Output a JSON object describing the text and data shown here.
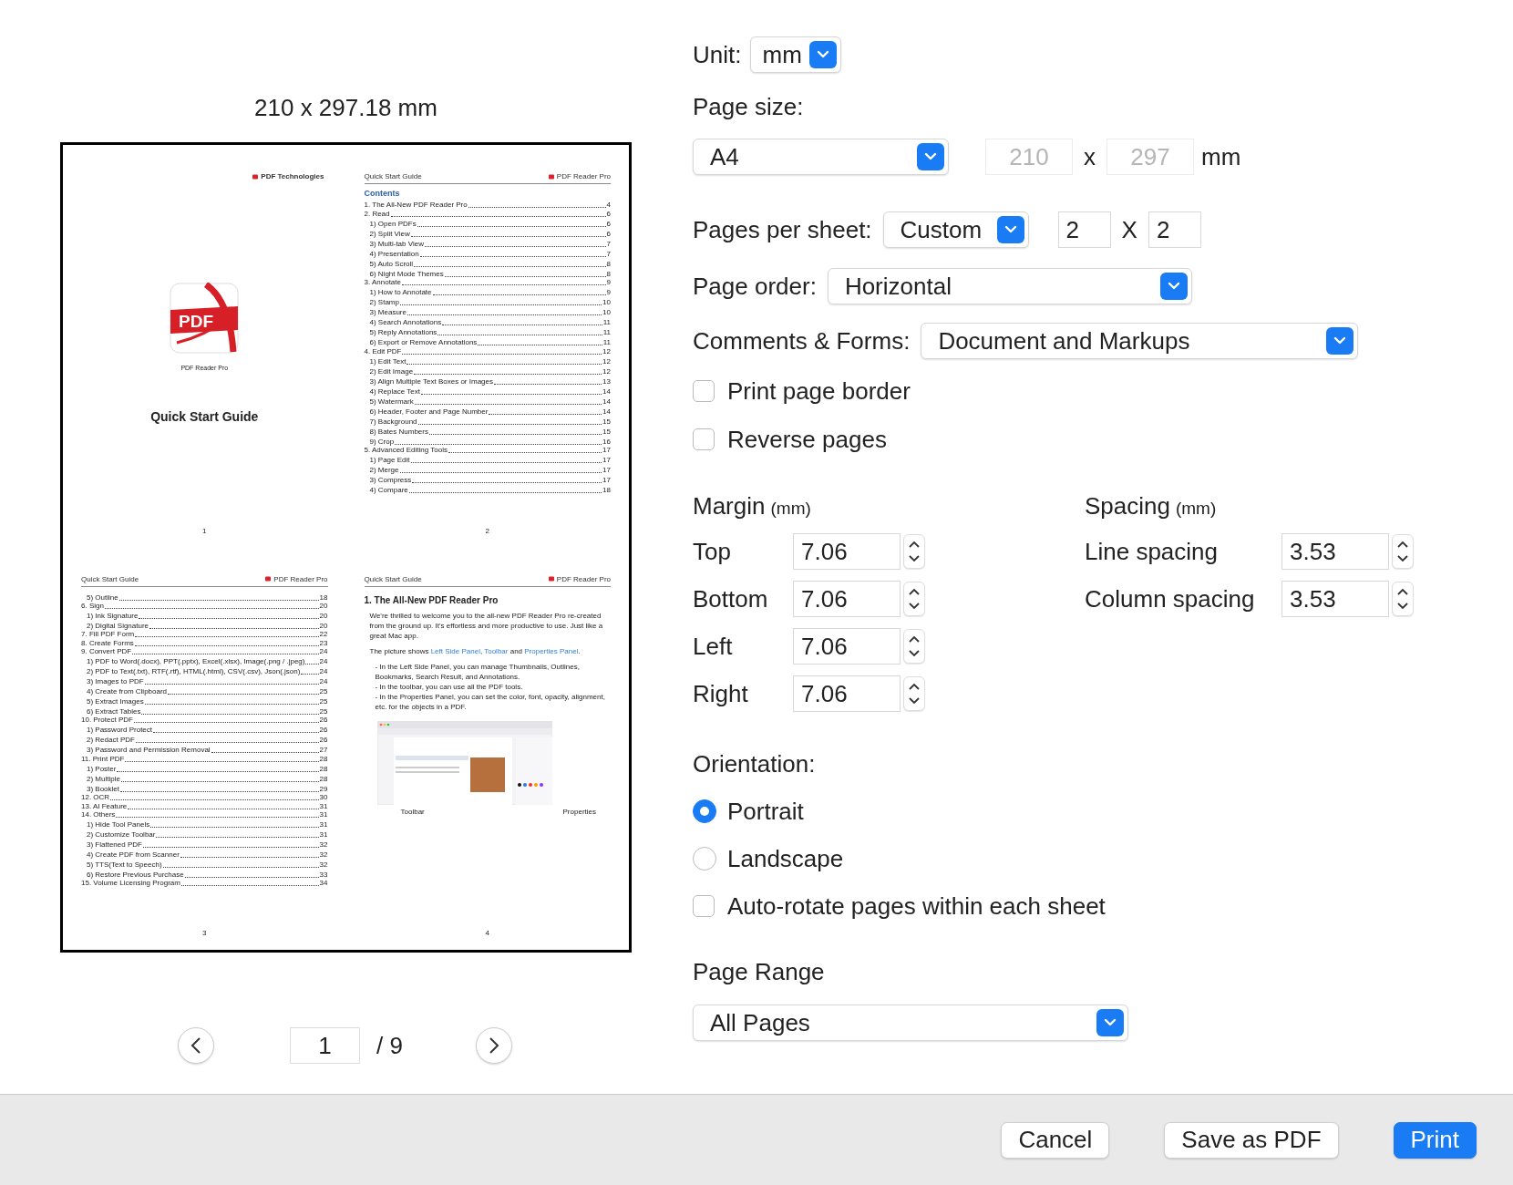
{
  "preview": {
    "size_label": "210 x 297.18 mm",
    "pages": [
      {
        "kind": "cover",
        "brand": "PDF Technologies",
        "icon_text": "PDF",
        "app_name": "PDF Reader Pro",
        "title": "Quick Start Guide",
        "number": "1"
      },
      {
        "kind": "toc",
        "header": "Quick Start Guide",
        "brand": "PDF Reader Pro",
        "heading": "Contents",
        "number": "2",
        "entries": [
          {
            "title": "1.  The All-New PDF Reader Pro",
            "page": "4"
          },
          {
            "title": "2. Read",
            "page": "6",
            "children": [
              {
                "title": "1) Open PDFs",
                "page": "6"
              },
              {
                "title": "2) Split View",
                "page": "6"
              },
              {
                "title": "3) Multi-tab View",
                "page": "7"
              },
              {
                "title": "4) Presentation",
                "page": "7"
              },
              {
                "title": "5) Auto Scroll",
                "page": "8"
              },
              {
                "title": "6) Night Mode Themes",
                "page": "8"
              }
            ]
          },
          {
            "title": "3. Annotate",
            "page": "9",
            "children": [
              {
                "title": "1) How to Annotate",
                "page": "9"
              },
              {
                "title": "2) Stamp",
                "page": "10"
              },
              {
                "title": "3) Measure",
                "page": "10"
              },
              {
                "title": "4) Search Annotations",
                "page": "11"
              },
              {
                "title": "5) Reply Annotations",
                "page": "11"
              },
              {
                "title": "6) Export or Remove Annotations",
                "page": "11"
              }
            ]
          },
          {
            "title": "4. Edit PDF",
            "page": "12",
            "children": [
              {
                "title": "1) Edit Text",
                "page": "12"
              },
              {
                "title": "2) Edit Image",
                "page": "12"
              },
              {
                "title": "3) Align Multiple Text Boxes or Images",
                "page": "13"
              },
              {
                "title": "4) Replace Text",
                "page": "14"
              },
              {
                "title": "5) Watermark",
                "page": "14"
              },
              {
                "title": "6) Header, Footer and Page Number",
                "page": "14"
              },
              {
                "title": "7) Background",
                "page": "15"
              },
              {
                "title": "8) Bates Numbers",
                "page": "15"
              },
              {
                "title": "9) Crop",
                "page": "16"
              }
            ]
          },
          {
            "title": "5. Advanced Editing Tools",
            "page": "17",
            "children": [
              {
                "title": "1) Page Edit",
                "page": "17"
              },
              {
                "title": "2) Merge",
                "page": "17"
              },
              {
                "title": "3) Compress",
                "page": "17"
              },
              {
                "title": "4) Compare",
                "page": "18"
              }
            ]
          }
        ]
      },
      {
        "kind": "toc",
        "header": "Quick Start Guide",
        "brand": "PDF Reader Pro",
        "continued": [
          {
            "title": "5) Outline",
            "page": "18"
          }
        ],
        "number": "3",
        "entries": [
          {
            "title": "6. Sign",
            "page": "20",
            "children": [
              {
                "title": "1) Ink Signature",
                "page": "20"
              },
              {
                "title": "2) Digital Signature",
                "page": "20"
              }
            ]
          },
          {
            "title": "7. Fill PDF Form",
            "page": "22"
          },
          {
            "title": "8. Create Forms",
            "page": "23"
          },
          {
            "title": "9. Convert PDF",
            "page": "24",
            "children": [
              {
                "title": "1) PDF to Word(.docx), PPT(.pptx), Excel(.xlsx), Image(.png / .jpeg)",
                "page": "24"
              },
              {
                "title": "2) PDF to Text(.txt), RTF(.rtf), HTML(.html), CSV(.csv), Json(.json)",
                "page": "24"
              },
              {
                "title": "3) Images to PDF",
                "page": "24"
              },
              {
                "title": "4) Create from Clipboard",
                "page": "25"
              },
              {
                "title": "5) Extract Images",
                "page": "25"
              },
              {
                "title": "6) Extract Tables",
                "page": "25"
              }
            ]
          },
          {
            "title": "10. Protect PDF",
            "page": "26",
            "children": [
              {
                "title": "1) Password Protect",
                "page": "26"
              },
              {
                "title": "2) Redact PDF",
                "page": "26"
              },
              {
                "title": "3) Password and Permission Removal",
                "page": "27"
              }
            ]
          },
          {
            "title": "11. Print PDF",
            "page": "28",
            "children": [
              {
                "title": "1) Poster",
                "page": "28"
              },
              {
                "title": "2) Multiple",
                "page": "28"
              },
              {
                "title": "3) Booklet",
                "page": "29"
              }
            ]
          },
          {
            "title": "12. OCR",
            "page": "30"
          },
          {
            "title": "13. AI Feature",
            "page": "31"
          },
          {
            "title": "14. Others",
            "page": "31",
            "children": [
              {
                "title": "1) Hide Tool Panels",
                "page": "31"
              },
              {
                "title": "2) Customize Toolbar",
                "page": "31"
              },
              {
                "title": "3) Flattened PDF",
                "page": "32"
              },
              {
                "title": "4) Create PDF from Scanner",
                "page": "32"
              },
              {
                "title": "5) TTS(Text to Speech)",
                "page": "32"
              },
              {
                "title": "6) Restore Previous Purchase",
                "page": "33"
              }
            ]
          },
          {
            "title": "15. Volume Licensing Program",
            "page": "34"
          }
        ]
      },
      {
        "kind": "article",
        "header": "Quick Start Guide",
        "brand": "PDF Reader Pro",
        "heading": "1.  The All-New PDF Reader Pro",
        "paragraph": "We're thrilled to welcome you to the all-new PDF Reader Pro re-created from the ground up. It's effortless and more productive to use. Just like a great Mac app.",
        "intro": [
          {
            "kind": "text",
            "text": "The picture shows "
          },
          {
            "kind": "link",
            "text": "Left Side Panel"
          },
          {
            "kind": "text",
            "text": ", "
          },
          {
            "kind": "link",
            "text": "Toolbar"
          },
          {
            "kind": "text",
            "text": " and "
          },
          {
            "kind": "link",
            "text": "Properties Panel"
          },
          {
            "kind": "text",
            "text": "."
          }
        ],
        "bullets": [
          "- In the Left Side Panel, you can manage Thumbnails, Outlines, Bookmarks, Search Result, and Annotations.",
          "- In the toolbar, you can use all the PDF tools.",
          "- In the Properties Panel, you can set the color, font, opacity, alignment, etc. for the objects in a PDF."
        ],
        "captions": [
          "Toolbar",
          "Properties"
        ],
        "number": "4"
      }
    ]
  },
  "navigation": {
    "page": "1",
    "total": "/ 9"
  },
  "settings": {
    "unit": {
      "label": "Unit:",
      "value": "mm"
    },
    "page_size": {
      "label": "Page size:",
      "value": "A4",
      "width": {
        "value": "210",
        "disabled": true
      },
      "times": "x",
      "height": {
        "value": "297",
        "disabled": true
      },
      "unit": "mm"
    },
    "pages_per_sheet": {
      "label": "Pages per sheet:",
      "value": "Custom",
      "columns": "2",
      "times": "X",
      "rows": "2"
    },
    "page_order": {
      "label": "Page order:",
      "value": "Horizontal"
    },
    "comments_forms": {
      "label": "Comments & Forms:",
      "value": "Document and Markups"
    },
    "options": [
      {
        "label": "Print page border",
        "checked": false
      },
      {
        "label": "Reverse pages",
        "checked": false
      }
    ],
    "margin": {
      "title": "Margin",
      "unit": "(mm)",
      "fields": [
        {
          "label": "Top",
          "value": "7.06"
        },
        {
          "label": "Bottom",
          "value": "7.06"
        },
        {
          "label": "Left",
          "value": "7.06"
        },
        {
          "label": "Right",
          "value": "7.06"
        }
      ]
    },
    "spacing": {
      "title": "Spacing",
      "unit": "(mm)",
      "fields": [
        {
          "label": "Line spacing",
          "value": "3.53"
        },
        {
          "label": "Column spacing",
          "value": "3.53"
        }
      ]
    },
    "orientation": {
      "label": "Orientation:",
      "choices": [
        {
          "label": "Portrait",
          "selected": true
        },
        {
          "label": "Landscape",
          "selected": false
        }
      ]
    },
    "auto_rotate": {
      "label": "Auto-rotate pages within each sheet",
      "checked": false
    },
    "page_range": {
      "label": "Page Range",
      "value": "All Pages"
    }
  },
  "buttons": [
    {
      "label": "Cancel",
      "kind": "secondary"
    },
    {
      "label": "Save as PDF",
      "kind": "secondary"
    },
    {
      "label": "Print",
      "kind": "primary"
    }
  ]
}
